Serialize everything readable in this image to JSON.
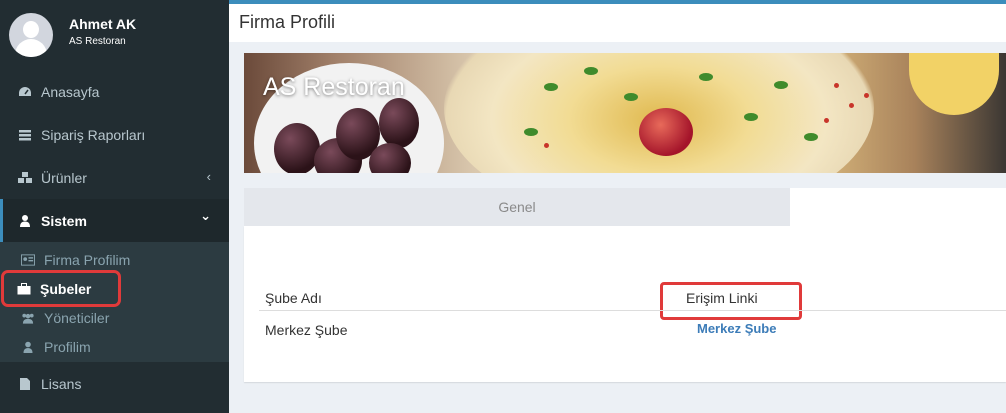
{
  "user": {
    "name": "Ahmet AK",
    "company": "AS Restoran"
  },
  "header": {
    "title": "Firma Profili"
  },
  "sidebar": {
    "items": [
      {
        "label": "Anasayfa",
        "icon": "dashboard-icon"
      },
      {
        "label": "Sipariş Raporları",
        "icon": "report-icon"
      },
      {
        "label": "Ürünler",
        "icon": "cubes-icon",
        "chevron": "‹"
      },
      {
        "label": "Sistem",
        "icon": "user-icon",
        "chevron": "⌄"
      },
      {
        "label": "Lisans",
        "icon": "file-icon"
      }
    ],
    "submenu": [
      {
        "label": "Firma Profilim",
        "icon": "id-card-icon"
      },
      {
        "label": "Şubeler",
        "icon": "briefcase-icon"
      },
      {
        "label": "Yöneticiler",
        "icon": "users-icon"
      },
      {
        "label": "Profilim",
        "icon": "user-icon"
      }
    ]
  },
  "banner": {
    "title": "AS Restoran"
  },
  "tabs": [
    {
      "label": "Genel"
    }
  ],
  "table": {
    "headers": [
      "Şube Adı",
      "Erişim Linki"
    ],
    "rows": [
      {
        "name": "Merkez Şube",
        "link": "Merkez Şube"
      }
    ]
  },
  "colors": {
    "sidebar_bg": "#222d32",
    "accent": "#3c8dbc",
    "highlight": "#e03a3a",
    "link": "#3c7cb8"
  }
}
